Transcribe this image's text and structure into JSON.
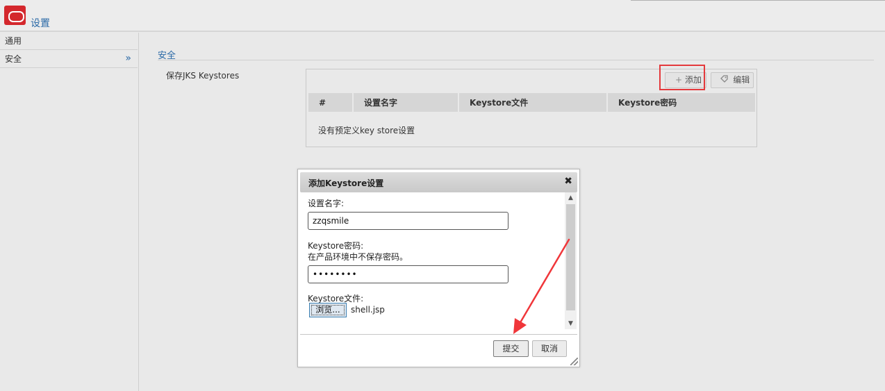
{
  "header": {
    "title": "设置",
    "logo_icon": "oracle-logo-icon"
  },
  "sidebar": {
    "items": [
      {
        "label": "通用"
      },
      {
        "label": "安全",
        "chevron": "»"
      }
    ]
  },
  "main": {
    "section_title": "安全",
    "field_label": "保存JKS Keystores",
    "toolbar": {
      "add_label": "添加",
      "add_icon": "+",
      "edit_label": "编辑",
      "edit_icon": "tag-icon"
    },
    "table": {
      "headers": [
        "#",
        "设置名字",
        "Keystore文件",
        "Keystore密码"
      ],
      "empty_message": "没有预定义key store设置"
    }
  },
  "dialog": {
    "title": "添加Keystore设置",
    "close_glyph": "✖",
    "name_label": "设置名字:",
    "name_value": "zzqsmile",
    "password_label": "Keystore密码:",
    "password_hint": "在产品环境中不保存密码。",
    "password_value": "••••••••",
    "file_label": "Keystore文件:",
    "browse_label": "浏览...",
    "file_name": "shell.jsp",
    "submit_label": "提交",
    "cancel_label": "取消"
  },
  "colors": {
    "accent": "#2a69a6",
    "logo": "#d4282d",
    "highlight": "#e4393c",
    "arrow": "#f0363a"
  }
}
